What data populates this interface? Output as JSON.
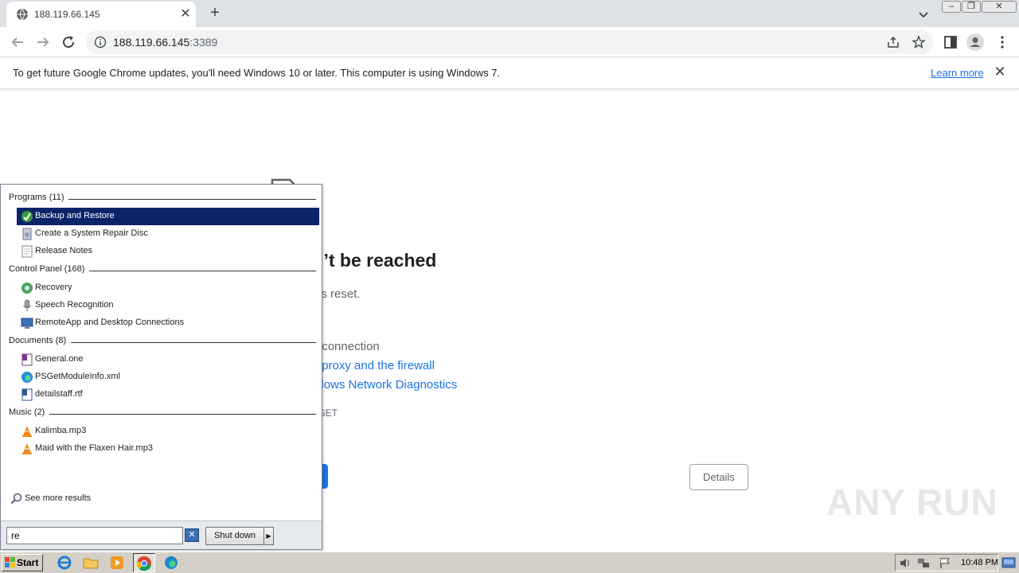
{
  "browser": {
    "tab_title": "188.119.66.145",
    "address_host": "188.119.66.145",
    "address_port": ":3389",
    "infobar_text": "To get future Google Chrome updates, you'll need Windows 10 or later. This computer is using Windows 7.",
    "infobar_link": "Learn more"
  },
  "error_page": {
    "title": "te can’t be reached",
    "subtitle": "ection was reset.",
    "suggestions": [
      {
        "text": "cking the connection",
        "link": false
      },
      {
        "text": "cking the proxy and the firewall",
        "link": true
      },
      {
        "text": "ning Windows Network Diagnostics",
        "link": true
      }
    ],
    "error_code": "CTION_RESET",
    "details_label": "Details"
  },
  "watermark": "ANY RUN",
  "start_menu": {
    "groups": [
      {
        "label": "Programs (11)",
        "items": [
          {
            "label": "Backup and Restore",
            "icon": "backup-restore-icon",
            "selected": true
          },
          {
            "label": "Create a System Repair Disc",
            "icon": "repair-disc-icon",
            "selected": false
          },
          {
            "label": "Release Notes",
            "icon": "document-icon",
            "selected": false
          }
        ]
      },
      {
        "label": "Control Panel (168)",
        "items": [
          {
            "label": "Recovery",
            "icon": "recovery-icon",
            "selected": false
          },
          {
            "label": "Speech Recognition",
            "icon": "microphone-icon",
            "selected": false
          },
          {
            "label": "RemoteApp and Desktop Connections",
            "icon": "remoteapp-icon",
            "selected": false
          }
        ]
      },
      {
        "label": "Documents (8)",
        "items": [
          {
            "label": "General.one",
            "icon": "onenote-icon",
            "selected": false
          },
          {
            "label": "PSGetModuleInfo.xml",
            "icon": "edge-file-icon",
            "selected": false
          },
          {
            "label": "detailstaff.rtf",
            "icon": "word-document-icon",
            "selected": false
          }
        ]
      },
      {
        "label": "Music (2)",
        "items": [
          {
            "label": "Kalimba.mp3",
            "icon": "vlc-icon",
            "selected": false
          },
          {
            "label": "Maid with the Flaxen Hair.mp3",
            "icon": "vlc-icon",
            "selected": false
          }
        ]
      }
    ],
    "see_more": "See more results",
    "search_value": "re",
    "shutdown_label": "Shut down"
  },
  "taskbar": {
    "start_label": "Start",
    "clock": "10:48 PM"
  }
}
